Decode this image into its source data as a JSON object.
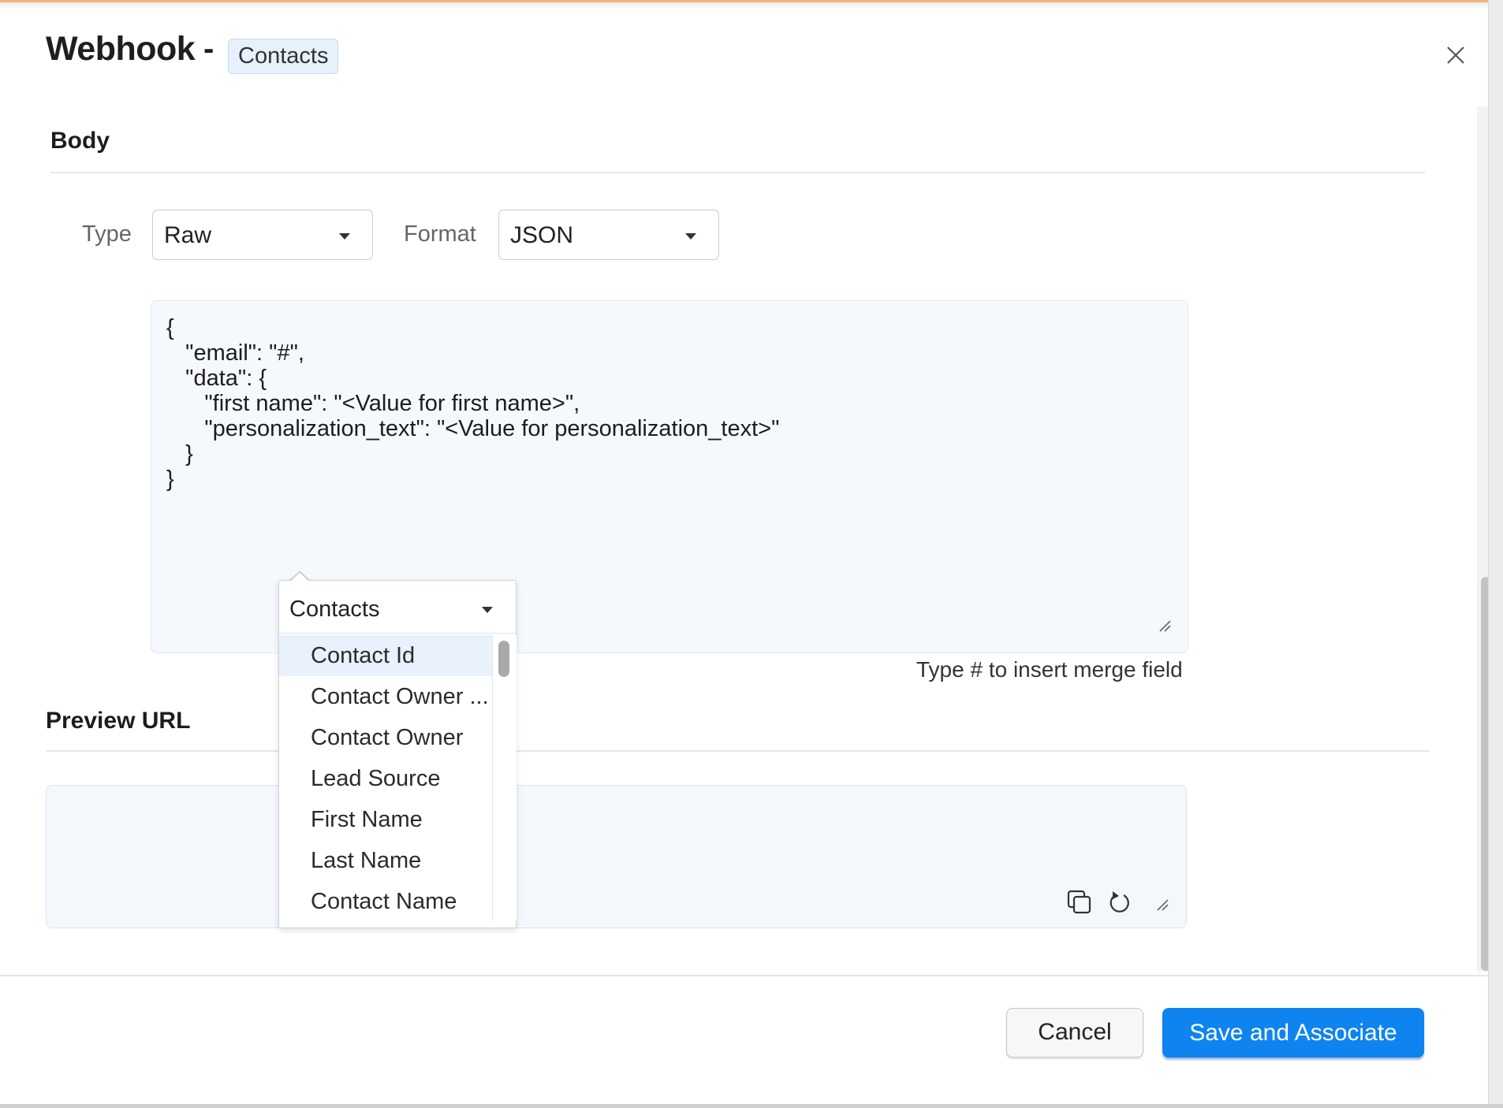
{
  "header": {
    "title": "Webhook",
    "separator": "-",
    "module_badge": "Contacts",
    "close_icon": "close-icon"
  },
  "body_section": {
    "title": "Body",
    "type_label": "Type",
    "type_value": "Raw",
    "format_label": "Format",
    "format_value": "JSON",
    "editor_content": "{\n   \"email\": \"#\",\n   \"data\": {\n      \"first name\": \"<Value for first name>\",\n      \"personalization_text\": \"<Value for personalization_text>\"\n   }\n}",
    "hint": "Type # to insert merge field"
  },
  "merge_dropdown": {
    "module": "Contacts",
    "items": [
      {
        "label": "Contact Id",
        "active": true
      },
      {
        "label": "Contact Owner ...",
        "active": false
      },
      {
        "label": "Contact Owner",
        "active": false
      },
      {
        "label": "Lead Source",
        "active": false
      },
      {
        "label": "First Name",
        "active": false
      },
      {
        "label": "Last Name",
        "active": false
      },
      {
        "label": "Contact Name",
        "active": false
      }
    ]
  },
  "preview_section": {
    "title": "Preview URL",
    "value": "",
    "icons": [
      "copy-icon",
      "refresh-icon"
    ]
  },
  "footer": {
    "cancel_label": "Cancel",
    "save_label": "Save and Associate"
  },
  "colors": {
    "primary": "#0f84f0",
    "editor_bg": "#f5f8fd",
    "badge_bg": "#e6f1fb",
    "active_item_bg": "#e8f1fc"
  }
}
